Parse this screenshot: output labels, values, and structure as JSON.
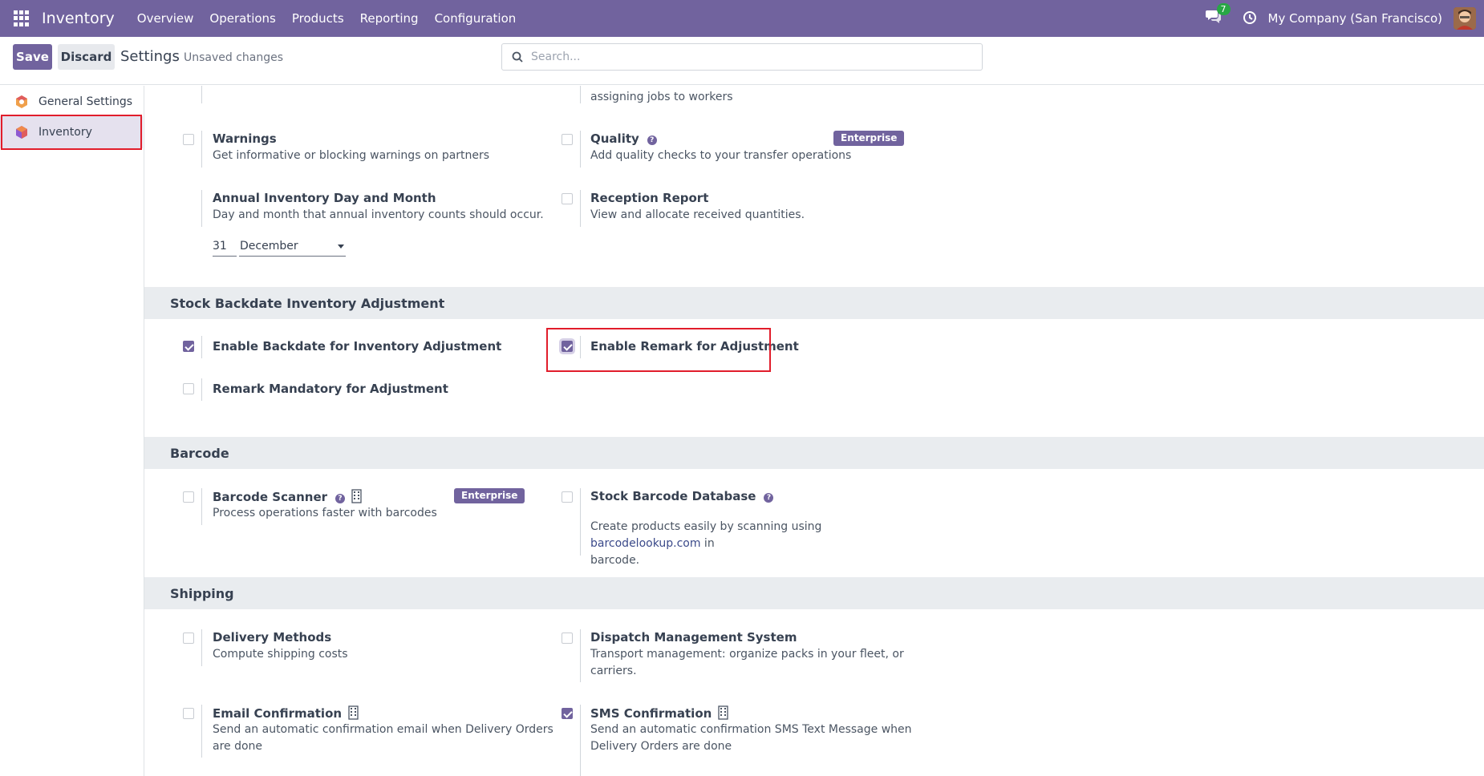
{
  "navbar": {
    "brand": "Inventory",
    "menu": [
      "Overview",
      "Operations",
      "Products",
      "Reporting",
      "Configuration"
    ],
    "chat_count": "7",
    "company": "My Company (San Francisco)"
  },
  "control": {
    "save_label": "Save",
    "discard_label": "Discard",
    "title": "Settings",
    "status": "Unsaved changes",
    "search_placeholder": "Search..."
  },
  "sidebar": {
    "items": [
      {
        "label": "General Settings"
      },
      {
        "label": "Inventory"
      }
    ]
  },
  "top_partial": {
    "right_desc_tail": "assigning jobs to workers"
  },
  "operations": {
    "warnings": {
      "label": "Warnings",
      "desc": "Get informative or blocking warnings on partners",
      "checked": false
    },
    "quality": {
      "label": "Quality",
      "desc": "Add quality checks to your transfer operations",
      "badge": "Enterprise",
      "checked": false
    },
    "annual": {
      "label": "Annual Inventory Day and Month",
      "desc": "Day and month that annual inventory counts should occur.",
      "day": "31",
      "month": "December"
    },
    "reception": {
      "label": "Reception Report",
      "desc": "View and allocate received quantities.",
      "checked": false
    }
  },
  "backdate": {
    "title": "Stock Backdate Inventory Adjustment",
    "enable_backdate": {
      "label": "Enable Backdate for Inventory Adjustment",
      "checked": true
    },
    "enable_remark": {
      "label": "Enable Remark for Adjustment",
      "checked": true
    },
    "remark_mandatory": {
      "label": "Remark Mandatory for Adjustment",
      "checked": false
    }
  },
  "barcode": {
    "title": "Barcode",
    "scanner": {
      "label": "Barcode Scanner",
      "desc": "Process operations faster with barcodes",
      "badge": "Enterprise",
      "checked": false
    },
    "database": {
      "label": "Stock Barcode Database",
      "desc_before": "Create products easily by scanning using ",
      "desc_link": "barcodelookup.com",
      "desc_after": " in",
      "desc_line2": "barcode.",
      "checked": false
    }
  },
  "shipping": {
    "title": "Shipping",
    "delivery": {
      "label": "Delivery Methods",
      "desc": "Compute shipping costs",
      "checked": false
    },
    "dispatch": {
      "label": "Dispatch Management System",
      "desc_line1": "Transport management: organize packs in your fleet, or",
      "desc_line2": "carriers.",
      "checked": false
    },
    "email": {
      "label": "Email Confirmation",
      "desc_line1": "Send an automatic confirmation email when Delivery Orders",
      "desc_line2": "are done",
      "checked": false
    },
    "sms": {
      "label": "SMS Confirmation",
      "desc_line1": "Send an automatic confirmation SMS Text Message when",
      "desc_line2": "Delivery Orders are done",
      "checked": true
    }
  },
  "colors": {
    "brand": "#71639e",
    "highlight_border": "#e11d2b",
    "section_bg": "#e9ecef"
  }
}
